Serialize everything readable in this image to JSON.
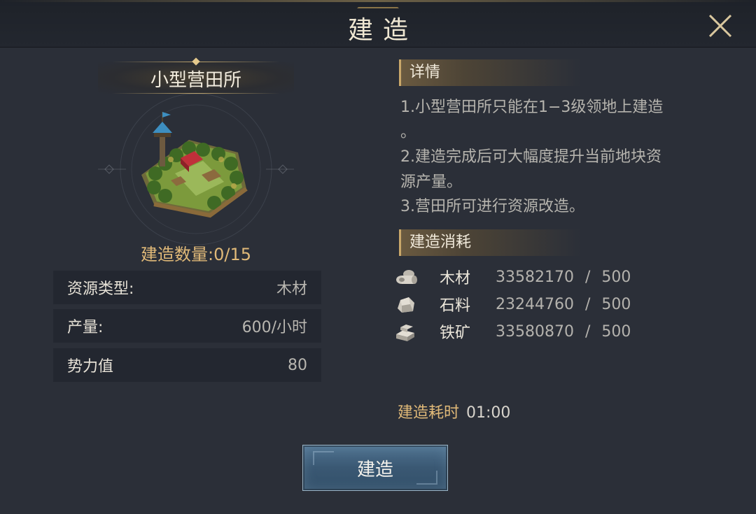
{
  "header": {
    "title": "建造"
  },
  "building": {
    "name": "小型营田所",
    "count_label": "建造数量:",
    "count_value": "0/15"
  },
  "stats": [
    {
      "label": "资源类型:",
      "value": "木材"
    },
    {
      "label": "产量:",
      "value": "600/小时"
    },
    {
      "label": "势力值",
      "value": "80"
    }
  ],
  "details": {
    "heading": "详情",
    "lines": [
      "1.小型营田所只能在1−3级领地上建造",
      "。",
      "2.建造完成后可大幅度提升当前地块资",
      "源产量。",
      "3.营田所可进行资源改造。"
    ]
  },
  "cost": {
    "heading": "建造消耗",
    "items": [
      {
        "icon": "wood-icon",
        "name": "木材",
        "have": "33582170",
        "sep": "/",
        "need": "500"
      },
      {
        "icon": "stone-icon",
        "name": "石料",
        "have": "23244760",
        "sep": "/",
        "need": "500"
      },
      {
        "icon": "iron-icon",
        "name": "铁矿",
        "have": "33580870",
        "sep": "/",
        "need": "500"
      }
    ]
  },
  "build_time": {
    "label": "建造耗时",
    "value": "01:00"
  },
  "actions": {
    "build_label": "建造"
  },
  "colors": {
    "background": "#2b2f38",
    "accent_gold": "#e0b978",
    "button_blue": "#3a5873"
  }
}
